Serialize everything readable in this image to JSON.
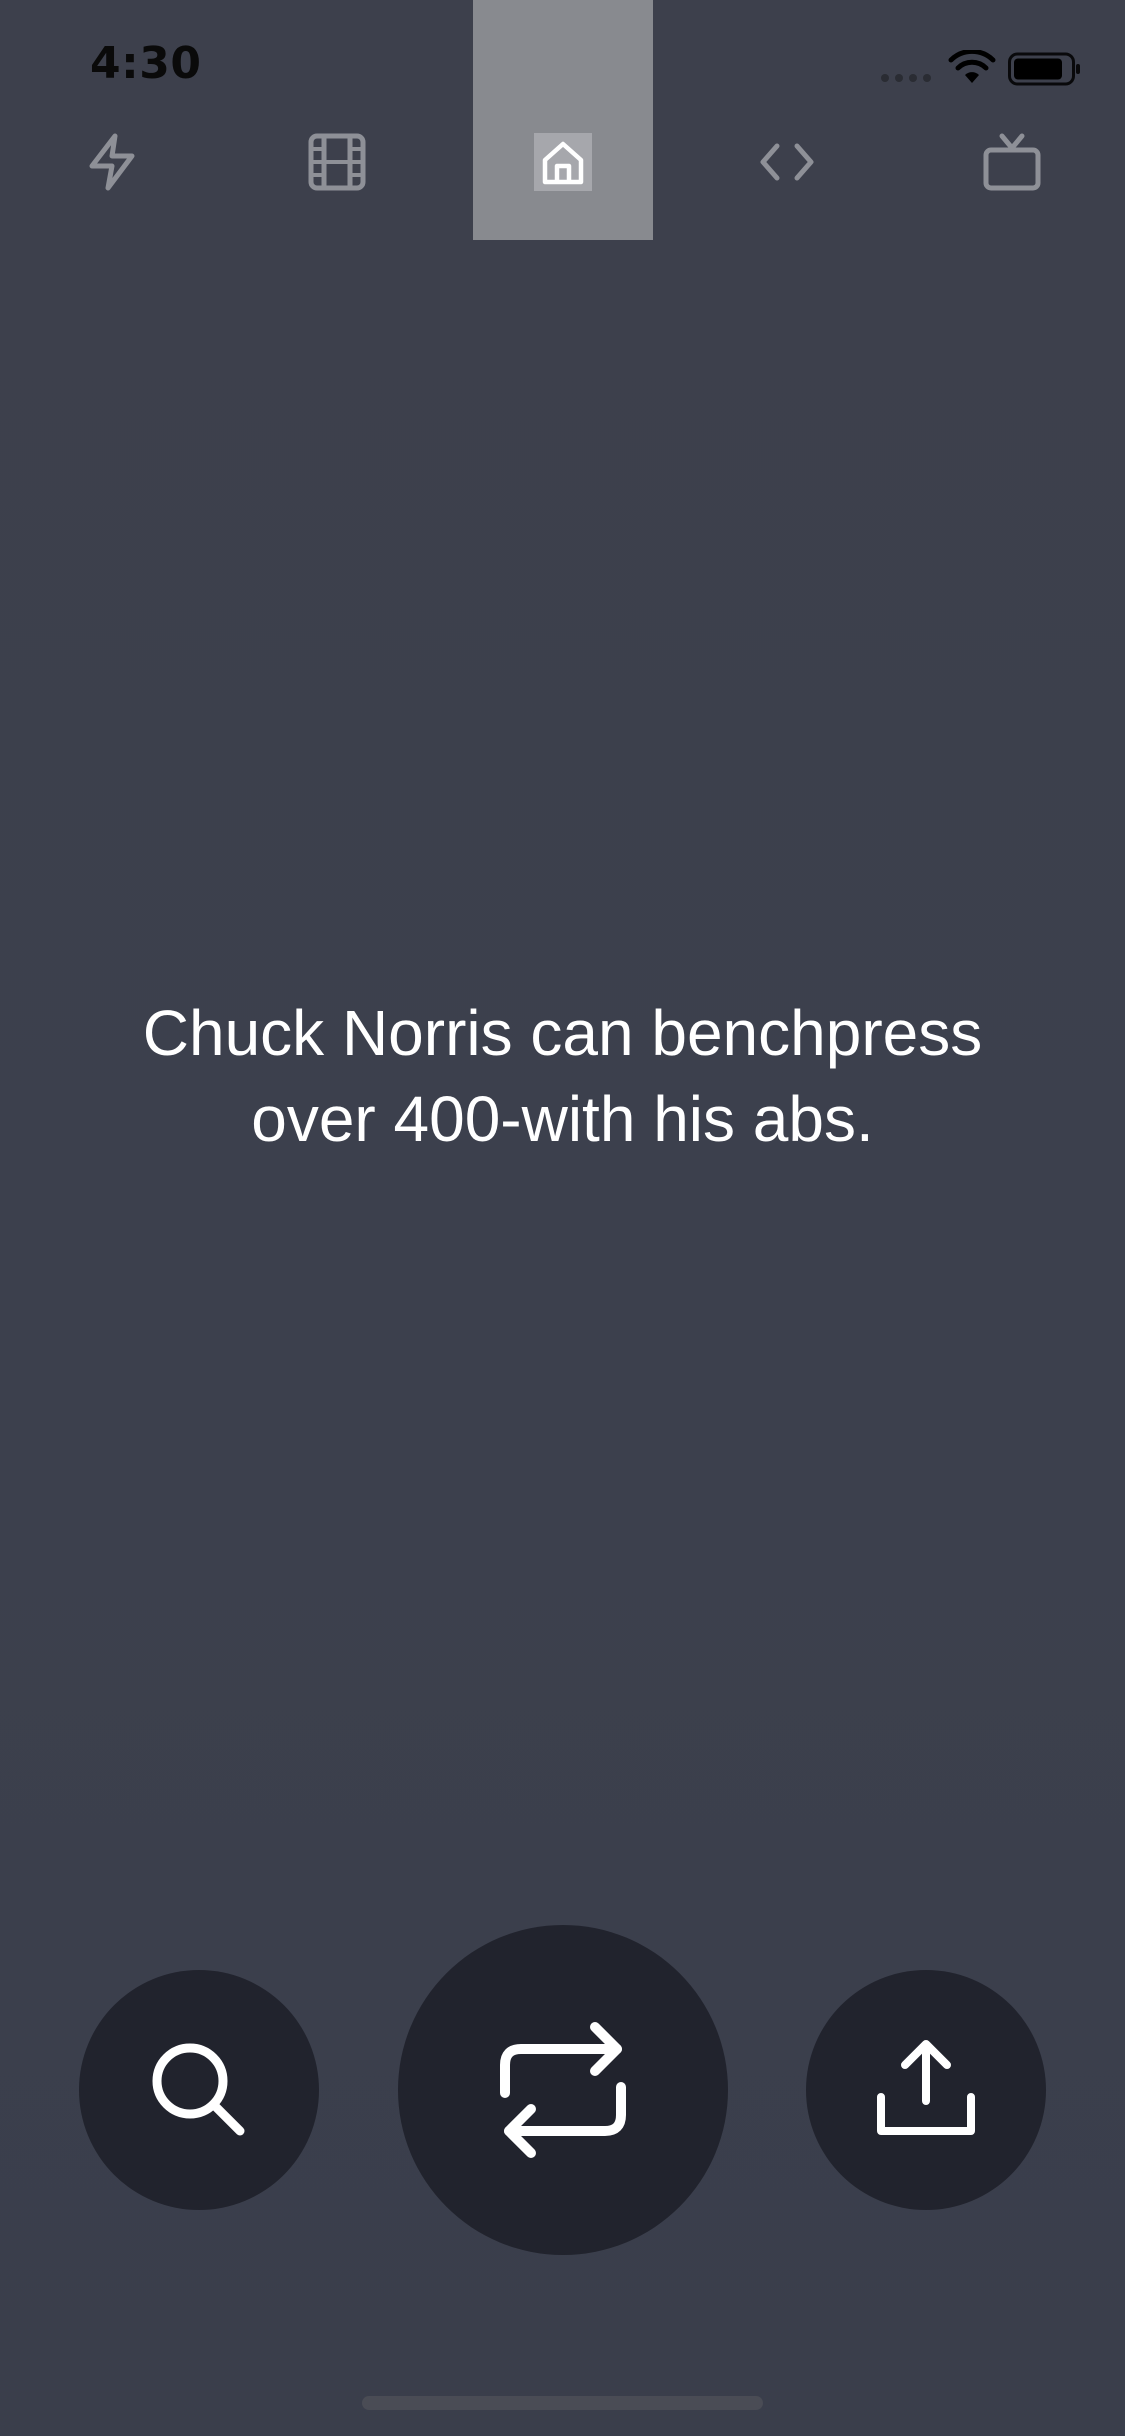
{
  "status_bar": {
    "time": "4:30",
    "icons": [
      "signal-dots-icon",
      "wifi-icon",
      "battery-icon"
    ]
  },
  "top_tabs": {
    "selected": "home",
    "items": [
      {
        "id": "bolt",
        "icon": "bolt-icon"
      },
      {
        "id": "film",
        "icon": "film-icon"
      },
      {
        "id": "home",
        "icon": "home-icon"
      },
      {
        "id": "code",
        "icon": "code-icon"
      },
      {
        "id": "tv",
        "icon": "tv-icon"
      }
    ]
  },
  "joke": {
    "line1": "Chuck Norris can benchpress",
    "line2": "over 400-with his abs."
  },
  "actions": [
    {
      "id": "search",
      "icon": "search-icon"
    },
    {
      "id": "refresh",
      "icon": "repeat-icon"
    },
    {
      "id": "share",
      "icon": "share-icon"
    }
  ],
  "colors": {
    "background": "#3c404d",
    "button_bg": "#21232d",
    "tab_icon": "#8e9097",
    "tab_highlight": "#888a8f",
    "text": "#ffffff"
  }
}
